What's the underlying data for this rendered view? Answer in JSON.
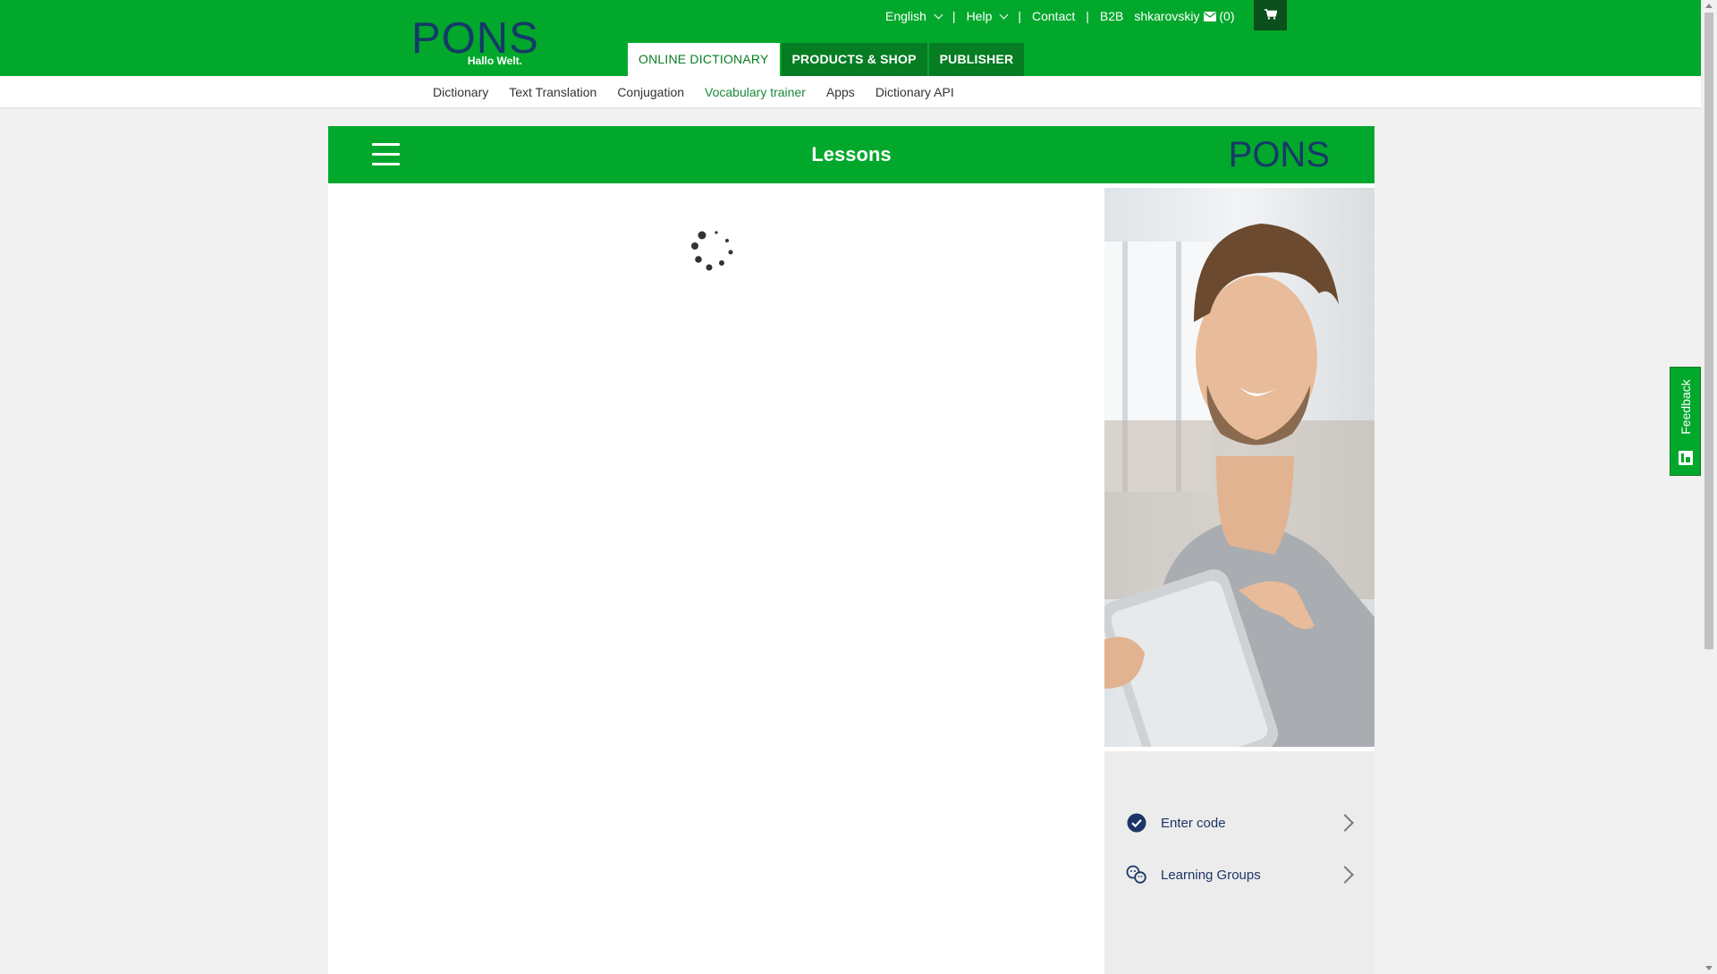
{
  "header": {
    "logo_text": "PONS",
    "logo_tagline": "Hallo Welt.",
    "top_links": {
      "language": "English",
      "help": "Help",
      "contact": "Contact",
      "b2b": "B2B",
      "user": "shkarovskiy",
      "messages_count": "(0)"
    },
    "main_tabs": [
      {
        "label": "ONLINE DICTIONARY",
        "active": true
      },
      {
        "label": "PRODUCTS & SHOP",
        "active": false
      },
      {
        "label": "PUBLISHER",
        "active": false
      }
    ]
  },
  "sub_nav": {
    "items": [
      {
        "label": "Dictionary",
        "active": false
      },
      {
        "label": "Text Translation",
        "active": false
      },
      {
        "label": "Conjugation",
        "active": false
      },
      {
        "label": "Vocabulary trainer",
        "active": true
      },
      {
        "label": "Apps",
        "active": false
      },
      {
        "label": "Dictionary API",
        "active": false
      }
    ]
  },
  "panel": {
    "title": "Lessons",
    "logo_text": "PONS"
  },
  "side_menu": {
    "items": [
      {
        "label": "Enter code",
        "icon": "check-circle-icon"
      },
      {
        "label": "Learning Groups",
        "icon": "group-icon"
      }
    ]
  },
  "feedback": {
    "label": "Feedback"
  },
  "colors": {
    "brand_green": "#02a82c",
    "dark_green": "#067d22",
    "navy": "#163a68"
  }
}
